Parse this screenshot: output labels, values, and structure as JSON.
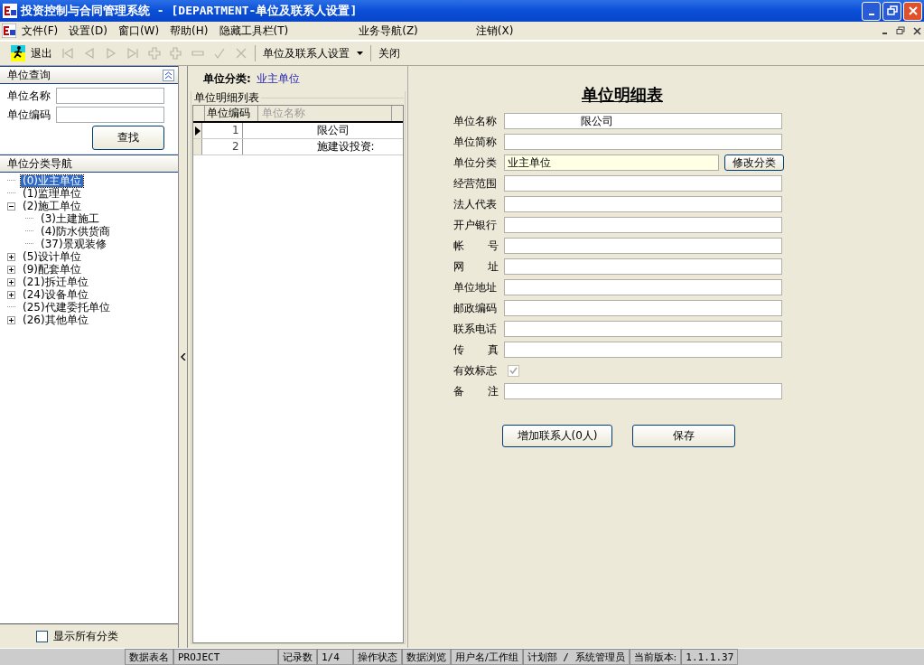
{
  "window": {
    "title": "投资控制与合同管理系统 - [DEPARTMENT-单位及联系人设置]"
  },
  "menu": [
    "文件(F)",
    "设置(D)",
    "窗口(W)",
    "帮助(H)",
    "隐藏工具栏(T)",
    "业务导航(Z)",
    "注销(X)"
  ],
  "toolbar": {
    "exit": "退出",
    "nav_buttons": [
      {
        "kind": "first",
        "disabled": true
      },
      {
        "kind": "prev",
        "disabled": true
      },
      {
        "kind": "next",
        "disabled": true
      },
      {
        "kind": "last",
        "disabled": true
      },
      {
        "kind": "add",
        "disabled": true
      },
      {
        "kind": "insert",
        "disabled": true
      },
      {
        "kind": "delete",
        "disabled": true
      },
      {
        "kind": "post",
        "disabled": true
      },
      {
        "kind": "cancel",
        "disabled": true
      }
    ],
    "dropdown": "单位及联系人设置",
    "close": "关闭"
  },
  "query": {
    "title": "单位查询",
    "fields": [
      {
        "label": "单位名称"
      },
      {
        "label": "单位编码"
      }
    ],
    "button": "查找"
  },
  "nav": {
    "title": "单位分类导航",
    "tree": [
      {
        "label": "(0)业主单位",
        "selected": true
      },
      {
        "label": "(1)监理单位",
        "selected": false
      },
      {
        "label": "(2)施工单位",
        "selected": false,
        "expanded": true,
        "children": [
          {
            "label": "(3)土建施工",
            "selected": false
          },
          {
            "label": "(4)防水供货商",
            "selected": false
          },
          {
            "label": "(37)景观装修",
            "selected": false
          }
        ]
      },
      {
        "label": "(5)设计单位",
        "selected": false,
        "expanded": false
      },
      {
        "label": "(9)配套单位",
        "selected": false,
        "expanded": false
      },
      {
        "label": "(21)拆迁单位",
        "selected": false,
        "expanded": false
      },
      {
        "label": "(24)设备单位",
        "selected": false,
        "expanded": false
      },
      {
        "label": "(25)代建委托单位",
        "selected": false
      },
      {
        "label": "(26)其他单位",
        "selected": false,
        "expanded": false
      }
    ],
    "show_all": {
      "label": "显示所有分类",
      "checked": false
    }
  },
  "category": {
    "label": "单位分类:",
    "value": "业主单位"
  },
  "list": {
    "title": "单位明细列表",
    "columns": [
      "单位编码",
      "单位名称"
    ],
    "rows": [
      {
        "code": "1",
        "name": "限公司",
        "selected": true
      },
      {
        "code": "2",
        "name": "施建设投资:",
        "selected": false
      }
    ]
  },
  "detail": {
    "title": "单位明细表",
    "fields": [
      {
        "kind": "text",
        "label": "单位名称",
        "value": "限公司"
      },
      {
        "kind": "text",
        "label": "单位简称"
      },
      {
        "kind": "text_button",
        "label": "单位分类",
        "value": "业主单位",
        "readonly": true,
        "button": "修改分类"
      },
      {
        "kind": "text",
        "label": "经营范围"
      },
      {
        "kind": "text",
        "label": "法人代表"
      },
      {
        "kind": "text",
        "label": "开户银行"
      },
      {
        "kind": "text",
        "label": "帐 号"
      },
      {
        "kind": "text",
        "label": "网 址"
      },
      {
        "kind": "text",
        "label": "单位地址"
      },
      {
        "kind": "text",
        "label": "邮政编码"
      },
      {
        "kind": "text",
        "label": "联系电话"
      },
      {
        "kind": "text",
        "label": "传 真"
      },
      {
        "kind": "checkbox",
        "label": "有效标志",
        "checked": true,
        "disabled": true
      },
      {
        "kind": "text",
        "label": "备 注"
      }
    ],
    "buttons": [
      "增加联系人(0人)",
      "保存"
    ]
  },
  "status_bar": [
    {
      "label": "数据表名",
      "value": "PROJECT"
    },
    {
      "label": "记录数",
      "value": "1/4"
    },
    {
      "label": "操作状态",
      "value": "数据浏览"
    },
    {
      "label": "用户名/工作组",
      "value": "计划部 / 系统管理员"
    },
    {
      "label": "当前版本:",
      "value": "1.1.1.37"
    }
  ]
}
